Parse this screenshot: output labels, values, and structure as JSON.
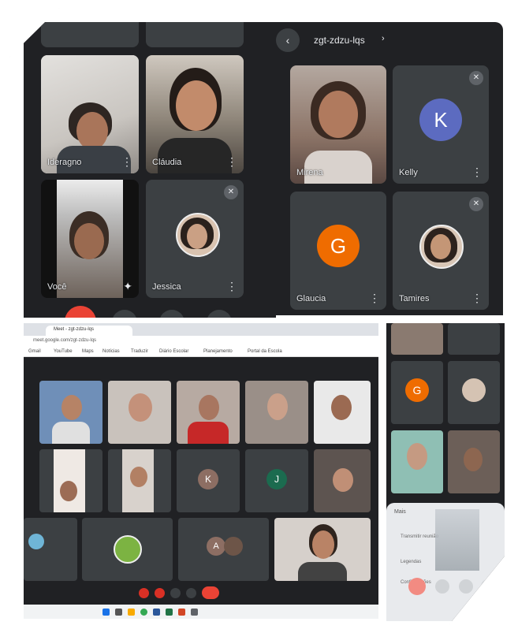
{
  "panel_a": {
    "tiles": [
      {
        "name": "Ideragno"
      },
      {
        "name": "Cláudia"
      },
      {
        "name": "Você"
      },
      {
        "name": "Jessica"
      }
    ]
  },
  "panel_b": {
    "meeting_code": "zgt-zdzu-lqs",
    "tiles": [
      {
        "name": "Mirena"
      },
      {
        "name": "Kelly",
        "initial": "K",
        "avatar_color": "#5c6bc0"
      },
      {
        "name": "Glaucia",
        "initial": "G",
        "avatar_color": "#ef6c00"
      },
      {
        "name": "Tamires"
      }
    ]
  },
  "panel_c": {
    "tab_title": "Meet - zgt-zdzu-lqs",
    "address": "meet.google.com/zgt-zdzu-lqs",
    "bookmarks": [
      "Gmail",
      "YouTube",
      "Maps",
      "Notícias",
      "Traduzir",
      "Diário Escolar",
      "Planejamento",
      "Portal da Escola"
    ],
    "avatars": [
      {
        "initial": "K",
        "color": "#8d6e63"
      },
      {
        "initial": "J",
        "color": "#1b6b4f"
      },
      {
        "initial": "A",
        "color": "#8d6e63"
      }
    ]
  },
  "panel_d": {
    "tile_initial": "G",
    "tile_color": "#ef6c00",
    "sheet_title": "Mais",
    "sheet_items": [
      "Transmitir reunião",
      "Legendas",
      "Configurações"
    ]
  }
}
